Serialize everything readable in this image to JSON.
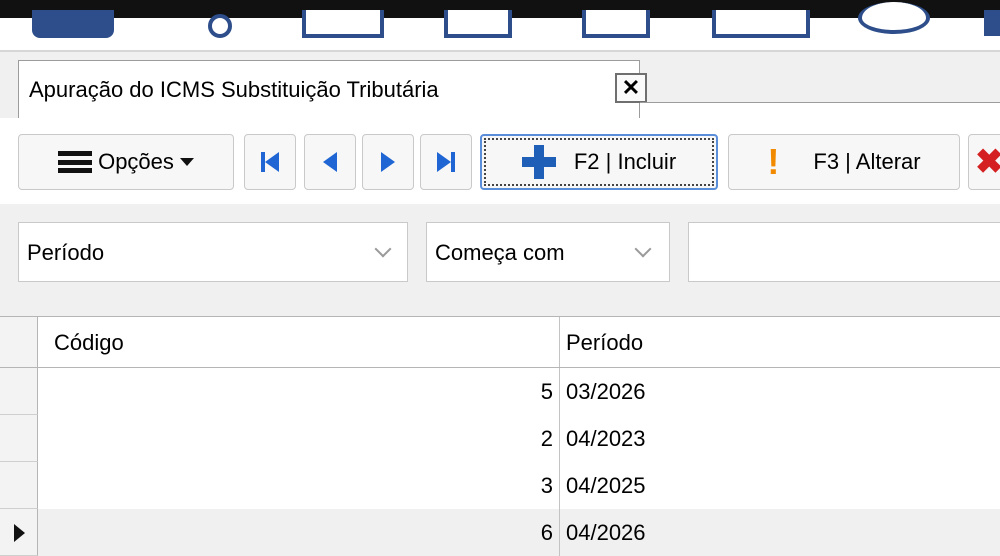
{
  "tab": {
    "title": "Apuração do ICMS Substituição Tributária",
    "close_label": "✕"
  },
  "toolbar": {
    "options_label": "Opções",
    "include_label": "F2 | Incluir",
    "alter_label": "F3 | Alterar"
  },
  "filter": {
    "field_value": "Período",
    "operator_value": "Começa com",
    "search_value": ""
  },
  "grid": {
    "columns": [
      "Código",
      "Período"
    ],
    "rows": [
      {
        "codigo": "5",
        "periodo": "03/2026"
      },
      {
        "codigo": "2",
        "periodo": "04/2023"
      },
      {
        "codigo": "3",
        "periodo": "04/2025"
      },
      {
        "codigo": "6",
        "periodo": "04/2026"
      }
    ],
    "current_row": 3
  },
  "colors": {
    "accent": "#1f66d4",
    "warning": "#f28a00",
    "danger": "#d42020"
  },
  "icons": [
    "menu-icon",
    "first-record-icon",
    "previous-record-icon",
    "next-record-icon",
    "last-record-icon",
    "plus-icon",
    "exclamation-icon",
    "delete-icon",
    "close-icon",
    "chevron-down-icon",
    "row-pointer-icon"
  ]
}
